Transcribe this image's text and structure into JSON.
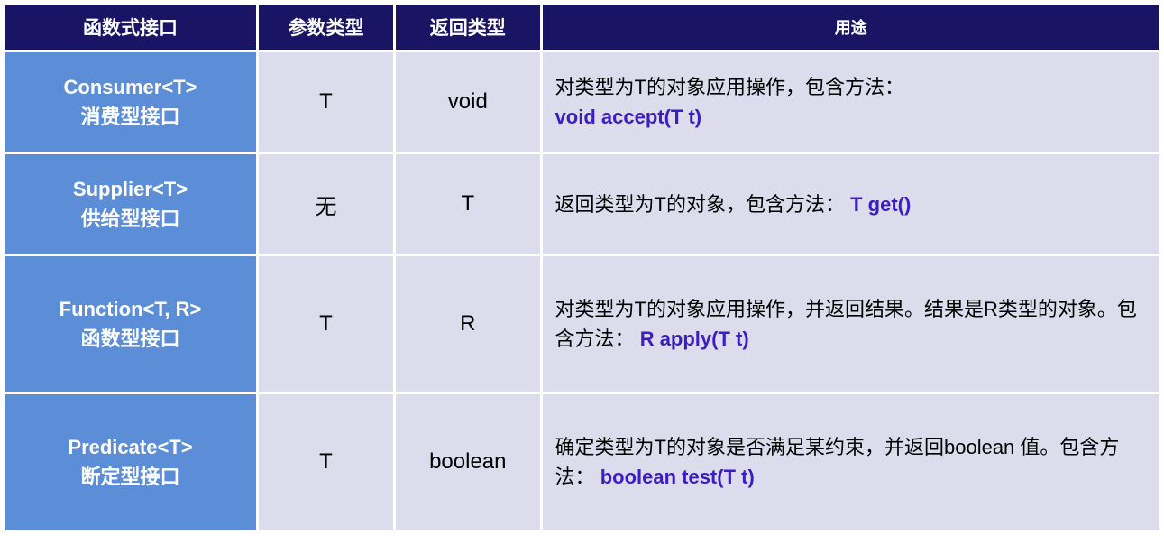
{
  "headers": {
    "interface": "函数式接口",
    "param": "参数类型",
    "return": "返回类型",
    "usage": "用途"
  },
  "rows": [
    {
      "interface_name": "Consumer<T>",
      "interface_desc": "消费型接口",
      "param": "T",
      "return": "void",
      "usage_text": "对类型为T的对象应用操作，包含方法：",
      "usage_method": "void accept(T t)",
      "method_break": true
    },
    {
      "interface_name": "Supplier<T>",
      "interface_desc": "供给型接口",
      "param": "无",
      "return": "T",
      "usage_text": "返回类型为T的对象，包含方法：",
      "usage_method": "T get()",
      "method_break": false
    },
    {
      "interface_name": "Function<T, R>",
      "interface_desc": "函数型接口",
      "param": "T",
      "return": "R",
      "usage_text": "对类型为T的对象应用操作，并返回结果。结果是R类型的对象。包含方法：",
      "usage_method": "R apply(T t)",
      "method_break": false
    },
    {
      "interface_name": "Predicate<T>",
      "interface_desc": "断定型接口",
      "param": "T",
      "return": "boolean",
      "usage_text": "确定类型为T的对象是否满足某约束，并返回boolean 值。包含方法：",
      "usage_method": "boolean test(T t)",
      "method_break": false
    }
  ]
}
